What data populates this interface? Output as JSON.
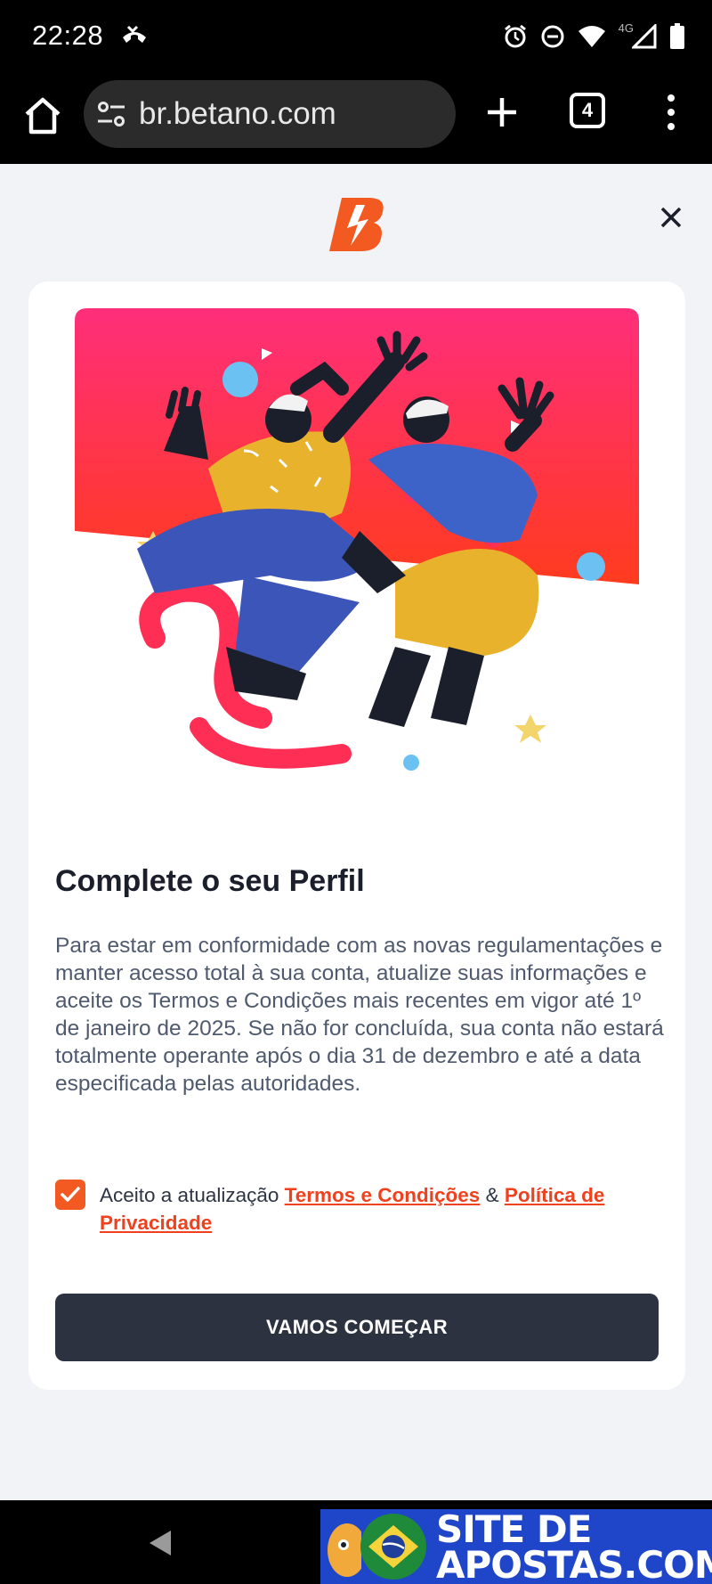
{
  "status_bar": {
    "time": "22:28",
    "network_label": "4G",
    "icons": [
      "missed-call-icon",
      "alarm-icon",
      "dnd-icon",
      "wifi-icon",
      "signal-icon",
      "battery-icon"
    ]
  },
  "browser": {
    "url": "br.betano.com",
    "tab_count": "4",
    "icons": [
      "home-icon",
      "site-settings-icon",
      "new-tab-icon",
      "tab-switcher-icon",
      "more-menu-icon"
    ]
  },
  "modal": {
    "logo": "betano-logo",
    "title": "Complete o seu Perfil",
    "body": "Para estar em conformidade com as novas regulamentações e manter acesso total à sua conta, atualize suas informações e aceite os Termos e Condições mais recentes em vigor até 1º de janeiro de 2025. Se não for concluída, sua conta não estará totalmente operante após o dia 31 de dezembro e até a data especificada pelas autoridades.",
    "consent": {
      "checked": true,
      "prefix": "Aceito a atualização",
      "terms_link": "Termos e Condições",
      "separator": "&",
      "privacy_link": "Política de Privacidade"
    },
    "cta_label": "VAMOS COMEÇAR"
  },
  "watermark": {
    "line1": "SITE DE",
    "line2": "APOSTAS.COM"
  },
  "colors": {
    "accent": "#f25a22",
    "link": "#f0401e",
    "button": "#2c3240",
    "background": "#f2f3f7"
  }
}
